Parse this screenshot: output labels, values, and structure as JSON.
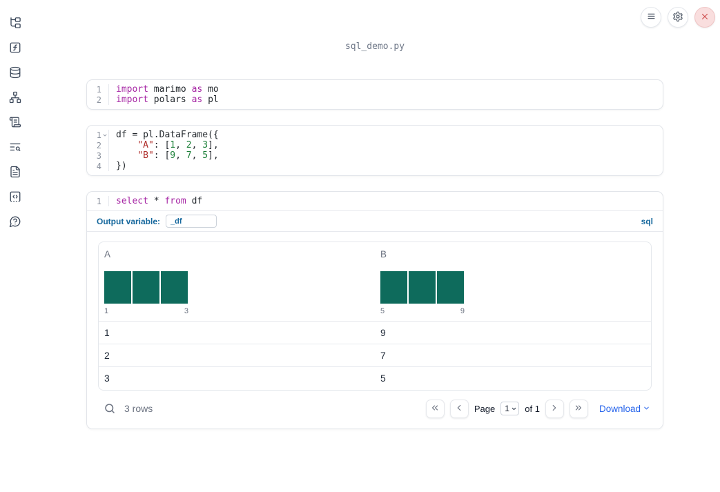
{
  "app": {
    "filename": "sql_demo.py"
  },
  "topbar": {
    "buttons": [
      {
        "icon": "menu-icon",
        "name": "notebook-menu"
      },
      {
        "icon": "gear-icon",
        "name": "settings"
      },
      {
        "icon": "close-icon",
        "name": "shutdown"
      }
    ]
  },
  "sidebar": {
    "items": [
      {
        "icon": "file-explorer-tree-icon"
      },
      {
        "icon": "function-square-icon"
      },
      {
        "icon": "database-icon"
      },
      {
        "icon": "dependency-graph-icon"
      },
      {
        "icon": "scroll-outline-icon"
      },
      {
        "icon": "text-search-logs-icon"
      },
      {
        "icon": "file-text-documentation-icon"
      },
      {
        "icon": "code-snippets-icon"
      },
      {
        "icon": "help-question-bubble-icon"
      }
    ]
  },
  "cells": [
    {
      "id": "imports",
      "lines": [
        {
          "no": "1",
          "tokens": [
            {
              "t": "kw",
              "v": "import"
            },
            {
              "t": "pl",
              "v": " marimo "
            },
            {
              "t": "kw",
              "v": "as"
            },
            {
              "t": "pl",
              "v": " mo"
            }
          ]
        },
        {
          "no": "2",
          "tokens": [
            {
              "t": "kw",
              "v": "import"
            },
            {
              "t": "pl",
              "v": " polars "
            },
            {
              "t": "kw",
              "v": "as"
            },
            {
              "t": "pl",
              "v": " pl"
            }
          ]
        }
      ]
    },
    {
      "id": "dataframe",
      "lines": [
        {
          "no": "1",
          "fold": true,
          "tokens": [
            {
              "t": "pl",
              "v": "df = pl.DataFrame({"
            }
          ]
        },
        {
          "no": "2",
          "tokens": [
            {
              "t": "pl",
              "v": "    "
            },
            {
              "t": "str",
              "v": "\"A\""
            },
            {
              "t": "pl",
              "v": ": ["
            },
            {
              "t": "num",
              "v": "1"
            },
            {
              "t": "pl",
              "v": ", "
            },
            {
              "t": "num",
              "v": "2"
            },
            {
              "t": "pl",
              "v": ", "
            },
            {
              "t": "num",
              "v": "3"
            },
            {
              "t": "pl",
              "v": "],"
            }
          ]
        },
        {
          "no": "3",
          "tokens": [
            {
              "t": "pl",
              "v": "    "
            },
            {
              "t": "str",
              "v": "\"B\""
            },
            {
              "t": "pl",
              "v": ": ["
            },
            {
              "t": "num",
              "v": "9"
            },
            {
              "t": "pl",
              "v": ", "
            },
            {
              "t": "num",
              "v": "7"
            },
            {
              "t": "pl",
              "v": ", "
            },
            {
              "t": "num",
              "v": "5"
            },
            {
              "t": "pl",
              "v": "],"
            }
          ]
        },
        {
          "no": "4",
          "tokens": [
            {
              "t": "pl",
              "v": "})"
            }
          ]
        }
      ]
    },
    {
      "id": "sql-query",
      "lines": [
        {
          "no": "1",
          "tokens": [
            {
              "t": "kw",
              "v": "select"
            },
            {
              "t": "pl",
              "v": " * "
            },
            {
              "t": "kw",
              "v": "from"
            },
            {
              "t": "pl",
              "v": " df"
            }
          ]
        }
      ]
    }
  ],
  "sql_cell": {
    "output_variable_label": "Output variable:",
    "output_variable_value": "_df",
    "language_badge": "sql"
  },
  "table": {
    "columns": [
      "A",
      "B"
    ],
    "rows": [
      [
        "1",
        "9"
      ],
      [
        "2",
        "7"
      ],
      [
        "3",
        "5"
      ]
    ]
  },
  "table_footer": {
    "row_count": "3 rows",
    "page_label": "Page",
    "page_value": "1",
    "of_label": "of 1",
    "download_label": "Download"
  },
  "chart_data": [
    {
      "type": "bar",
      "title": "A",
      "categories": [
        "1",
        "2",
        "3"
      ],
      "values": [
        1,
        1,
        1
      ],
      "x_min_label": "1",
      "x_max_label": "3",
      "bar_color": "#0E6B5C",
      "ylim": [
        0,
        1
      ]
    },
    {
      "type": "bar",
      "title": "B",
      "categories": [
        "5",
        "7",
        "9"
      ],
      "values": [
        1,
        1,
        1
      ],
      "x_min_label": "5",
      "x_max_label": "9",
      "bar_color": "#0E6B5C",
      "ylim": [
        0,
        1
      ]
    }
  ],
  "colors": {
    "accent_blue": "#16689D",
    "link_blue": "#2563EB",
    "bar_green": "#0E6B5C",
    "keyword": "#A626A4",
    "string": "#B0302C",
    "number": "#1A7F37",
    "close_red": "#CF5151"
  }
}
